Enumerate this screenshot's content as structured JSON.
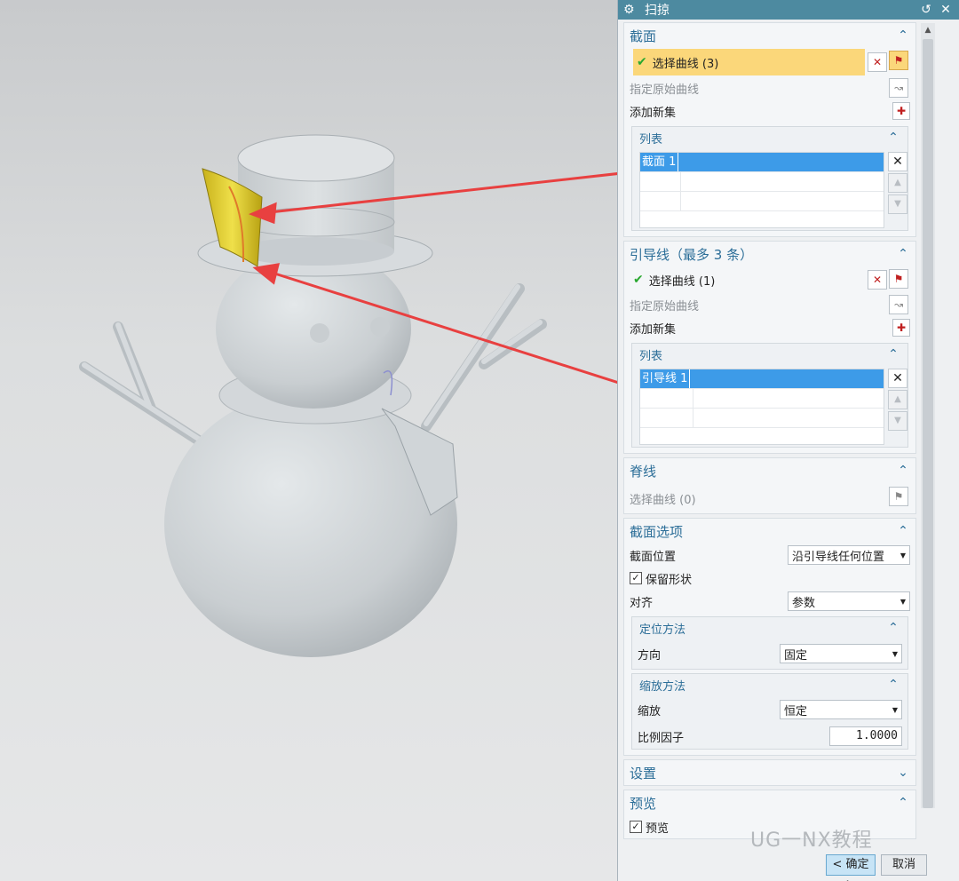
{
  "dialog": {
    "title": "扫掠",
    "title_icon": "gear-icon",
    "reset_icon": "reset-icon",
    "close_icon": "close-icon"
  },
  "section_profile": {
    "title": "截面",
    "select_curve": "选择曲线 (3)",
    "specify_origin": "指定原始曲线",
    "add_new_set": "添加新集",
    "list_title": "列表",
    "list_item": "截面 1"
  },
  "section_guide": {
    "title": "引导线（最多 3 条）",
    "select_curve": "选择曲线 (1)",
    "specify_origin": "指定原始曲线",
    "add_new_set": "添加新集",
    "list_title": "列表",
    "list_item": "引导线 1"
  },
  "section_spine": {
    "title": "脊线",
    "select_curve": "选择曲线 (0)"
  },
  "section_options": {
    "title": "截面选项",
    "location_label": "截面位置",
    "location_value": "沿引导线任何位置",
    "preserve_shape": "保留形状",
    "align_label": "对齐",
    "align_value": "参数",
    "orientation": {
      "title": "定位方法",
      "direction_label": "方向",
      "direction_value": "固定"
    },
    "scaling": {
      "title": "缩放方法",
      "scale_label": "缩放",
      "scale_value": "恒定",
      "factor_label": "比例因子",
      "factor_value": "1.0000"
    }
  },
  "section_settings": {
    "title": "设置"
  },
  "section_preview": {
    "title": "预览",
    "preview_label": "预览"
  },
  "buttons": {
    "ok": "< 确定 >",
    "cancel": "取消"
  },
  "watermark": "UG一NX教程"
}
